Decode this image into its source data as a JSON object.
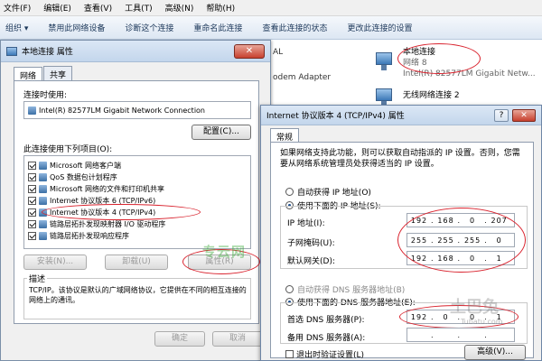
{
  "menubar": [
    "文件(F)",
    "编辑(E)",
    "查看(V)",
    "工具(T)",
    "高级(N)",
    "帮助(H)"
  ],
  "toolbar": [
    "组织 ▾",
    "禁用此网络设备",
    "诊断这个连接",
    "重命名此连接",
    "查看此连接的状态",
    "更改此连接的设置"
  ],
  "explorer": {
    "partial_top": "AL",
    "partial_modem": "odem Adapter",
    "conn1": {
      "name": "本地连接",
      "network": "网络 8",
      "adapter": "Intel(R) 82577LM Gigabit Netw..."
    },
    "conn2": {
      "name": "无线网络连接 2"
    }
  },
  "props": {
    "title": "本地连接 属性",
    "close": "✕",
    "tabs": [
      "网络",
      "共享"
    ],
    "connect_using_label": "连接时使用:",
    "adapter": "Intel(R) 82577LM Gigabit Network Connection",
    "configure": "配置(C)...",
    "items_label": "此连接使用下列项目(O):",
    "items": [
      {
        "label": "Microsoft 网络客户端",
        "checked": true
      },
      {
        "label": "QoS 数据包计划程序",
        "checked": true
      },
      {
        "label": "Microsoft 网络的文件和打印机共享",
        "checked": true
      },
      {
        "label": "Internet 协议版本 6 (TCP/IPv6)",
        "checked": true
      },
      {
        "label": "Internet 协议版本 4 (TCP/IPv4)",
        "checked": true
      },
      {
        "label": "链路层拓扑发现映射器 I/O 驱动程序",
        "checked": true
      },
      {
        "label": "链路层拓扑发现响应程序",
        "checked": true
      }
    ],
    "install": "安装(N)...",
    "uninstall": "卸载(U)",
    "properties": "属性(R)",
    "description_label": "描述",
    "description": "TCP/IP。该协议是默认的广域网络协议，它提供在不同的相互连接的网络上的通讯。",
    "ok": "确定",
    "cancel": "取消"
  },
  "ipv4": {
    "title": "Internet 协议版本 4 (TCP/IPv4) 属性",
    "help": "?",
    "close": "✕",
    "tab": "常规",
    "intro": "如果网络支持此功能，则可以获取自动指派的 IP 设置。否则，您需要从网络系统管理员处获得适当的 IP 设置。",
    "auto_ip": "自动获得 IP 地址(O)",
    "use_ip": "使用下面的 IP 地址(S):",
    "ip_label": "IP 地址(I):",
    "ip_value": [
      "192",
      "168",
      "0",
      "207"
    ],
    "mask_label": "子网掩码(U):",
    "mask_value": [
      "255",
      "255",
      "255",
      "0"
    ],
    "gateway_label": "默认网关(D):",
    "gateway_value": [
      "192",
      "168",
      "0",
      "1"
    ],
    "auto_dns": "自动获得 DNS 服务器地址(B)",
    "use_dns": "使用下面的 DNS 服务器地址(E):",
    "dns1_label": "首选 DNS 服务器(P):",
    "dns1_value": [
      "192",
      "0",
      "0",
      "1"
    ],
    "dns2_label": "备用 DNS 服务器(A):",
    "dns2_value": [
      "",
      "",
      "",
      ""
    ],
    "validate": "退出时验证设置(L)",
    "advanced": "高级(V)..."
  },
  "watermark": {
    "green": "专云网",
    "grey": "土巴兔",
    "url": "Tubatu.com"
  }
}
